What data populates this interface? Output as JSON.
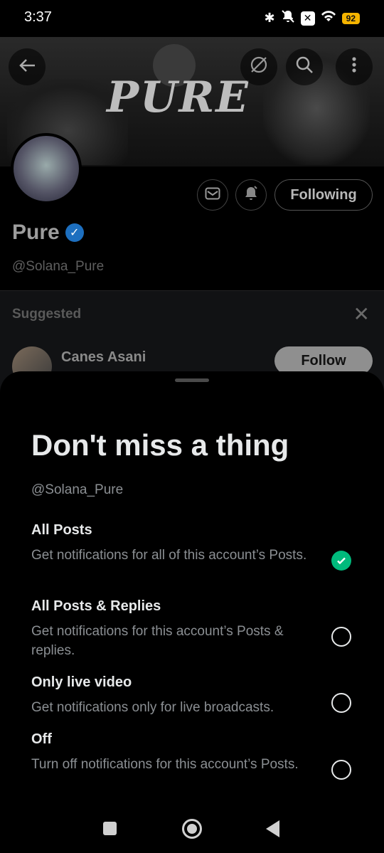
{
  "status_bar": {
    "time": "3:37",
    "battery": "92"
  },
  "profile": {
    "banner_text": "PURE",
    "name": "Pure",
    "handle": "@Solana_Pure",
    "following_label": "Following",
    "icons": [
      "back-arrow-icon",
      "visibility-off-icon",
      "search-icon",
      "more-vertical-icon",
      "mail-icon",
      "bell-add-icon",
      "verified-badge-icon"
    ]
  },
  "suggested": {
    "label": "Suggested",
    "user_name": "Canes Asani",
    "follow_label": "Follow"
  },
  "sheet": {
    "title": "Don't miss a thing",
    "handle": "@Solana_Pure",
    "options": [
      {
        "title": "All Posts",
        "description": "Get notifications for all of this account’s Posts.",
        "selected": true
      },
      {
        "title": "All Posts & Replies",
        "description": "Get notifications for this account’s Posts & replies.",
        "selected": false
      },
      {
        "title": "Only live video",
        "description": "Get notifications only for live broadcasts.",
        "selected": false
      },
      {
        "title": "Off",
        "description": "Turn off notifications for this account’s Posts.",
        "selected": false
      }
    ]
  },
  "colors": {
    "selected_green": "#00ba7c",
    "verified_blue": "#1d6fbf",
    "battery_yellow": "#f5b400"
  }
}
